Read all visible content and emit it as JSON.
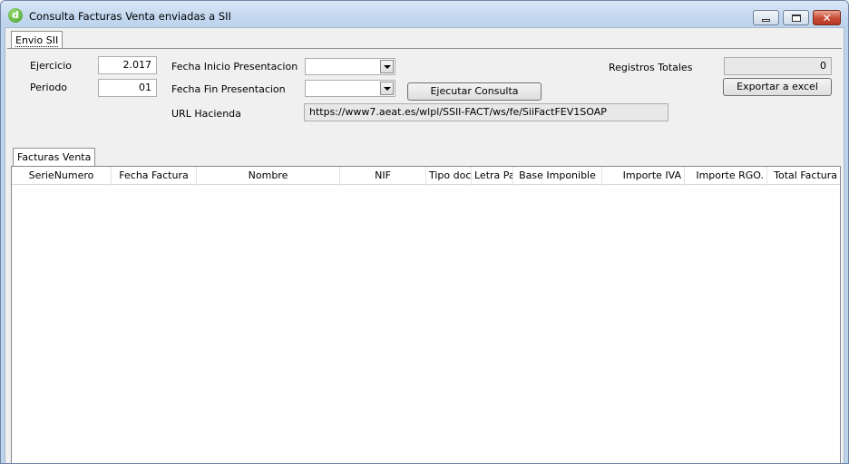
{
  "window": {
    "title": "Consulta Facturas Venta enviadas a SII",
    "app_icon_letter": "d"
  },
  "tabs": {
    "outer": "Envio SII",
    "inner": "Facturas Venta"
  },
  "form": {
    "ejercicio_label": "Ejercicio",
    "ejercicio_value": "2.017",
    "periodo_label": "Periodo",
    "periodo_value": "01",
    "fecha_inicio_label": "Fecha Inicio Presentacion",
    "fecha_inicio_value": "",
    "fecha_fin_label": "Fecha Fin Presentacion",
    "fecha_fin_value": "",
    "ejecutar_button": "Ejecutar Consulta",
    "url_label": "URL Hacienda",
    "url_value": "https://www7.aeat.es/wlpl/SSII-FACT/ws/fe/SiiFactFEV1SOAP",
    "registros_label": "Registros Totales",
    "registros_value": "0",
    "exportar_button": "Exportar a excel"
  },
  "grid": {
    "columns": [
      "SerieNumero",
      "Fecha Factura",
      "Nombre",
      "NIF",
      "Tipo doc",
      "Letra Pa",
      "Base Imponible",
      "Importe IVA",
      "Importe RGO.",
      "Total Factura"
    ],
    "rows": []
  }
}
